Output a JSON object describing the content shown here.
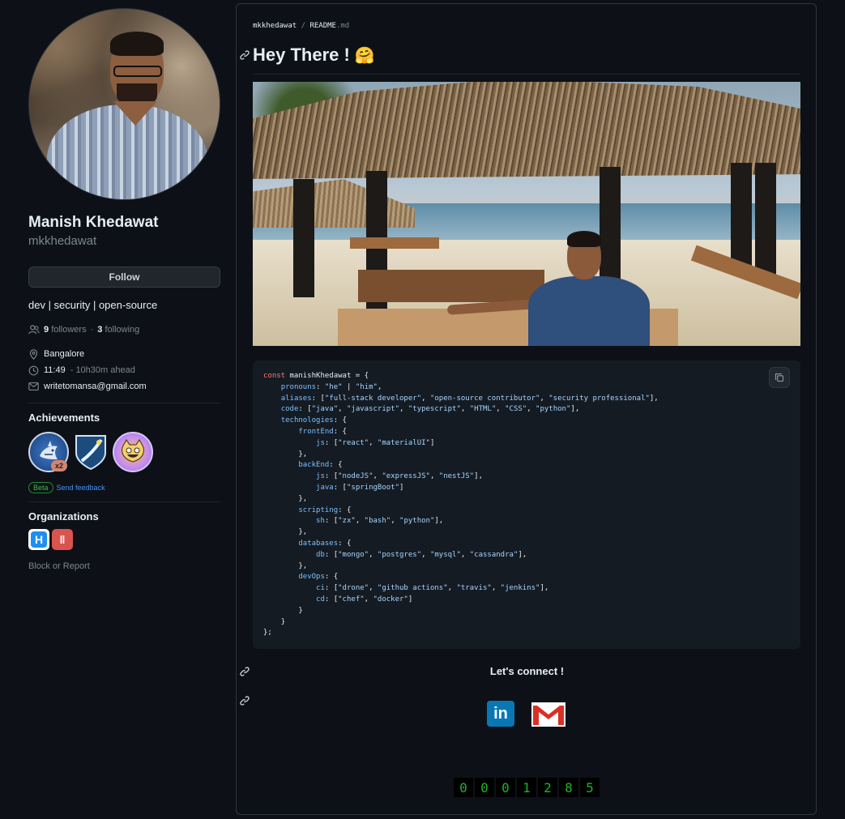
{
  "profile": {
    "name": "Manish Khedawat",
    "login": "mkkhedawat",
    "follow_label": "Follow",
    "bio": "dev | security | open-source",
    "followers_count": "9",
    "followers_label": "followers",
    "separator": "·",
    "following_count": "3",
    "following_label": "following",
    "location": "Bangalore",
    "time": "11:49",
    "time_offset": "- 10h30m ahead",
    "email": "writetomansa@gmail.com"
  },
  "achievements": {
    "title": "Achievements",
    "shark_count": "x2",
    "beta_label": "Beta",
    "feedback_label": "Send feedback"
  },
  "organizations": {
    "title": "Organizations",
    "org1_letter": "H",
    "org2_letter": "‖"
  },
  "block_label": "Block or Report",
  "readme": {
    "owner": "mkkhedawat",
    "slash": "/",
    "file": "README",
    "ext": ".md",
    "heading": "Hey There !",
    "heading_emoji": "🤗",
    "connect_heading": "Let's connect !",
    "linkedin_label": "in",
    "counter_digits": [
      "0",
      "0",
      "0",
      "1",
      "2",
      "8",
      "5"
    ]
  },
  "code_lines": [
    {
      "kw": "const",
      "rest": " manishKhedawat = {"
    },
    {
      "indent": "    ",
      "prop": "pronouns",
      "rest": ": \"he\" | \"him\","
    },
    {
      "indent": "    ",
      "prop": "aliases",
      "rest": ": [\"full-stack developer\", \"open-source contributor\", \"security professional\"],"
    },
    {
      "indent": "    ",
      "prop": "code",
      "rest": ": [\"java\", \"javascript\", \"typescript\", \"HTML\", \"CSS\", \"python\"],"
    },
    {
      "indent": "    ",
      "prop": "technologies",
      "rest": ": {"
    },
    {
      "indent": "        ",
      "prop": "frontEnd",
      "rest": ": {"
    },
    {
      "indent": "            ",
      "prop": "js",
      "rest": ": [\"react\", \"materialUI\"]"
    },
    {
      "indent": "        ",
      "rest": "},"
    },
    {
      "indent": "        ",
      "prop": "backEnd",
      "rest": ": {"
    },
    {
      "indent": "            ",
      "prop": "js",
      "rest": ": [\"nodeJS\", \"expressJS\", \"nestJS\"],"
    },
    {
      "indent": "            ",
      "prop": "java",
      "rest": ": [\"springBoot\"]"
    },
    {
      "indent": "        ",
      "rest": "},"
    },
    {
      "indent": "        ",
      "prop": "scripting",
      "rest": ": {"
    },
    {
      "indent": "            ",
      "prop": "sh",
      "rest": ": [\"zx\", \"bash\", \"python\"],"
    },
    {
      "indent": "        ",
      "rest": "},"
    },
    {
      "indent": "        ",
      "prop": "databases",
      "rest": ": {"
    },
    {
      "indent": "            ",
      "prop": "db",
      "rest": ": [\"mongo\", \"postgres\", \"mysql\", \"cassandra\"],"
    },
    {
      "indent": "        ",
      "rest": "},"
    },
    {
      "indent": "        ",
      "prop": "devOps",
      "rest": ": {"
    },
    {
      "indent": "            ",
      "prop": "ci",
      "rest": ": [\"drone\", \"github actions\", \"travis\", \"jenkins\"],"
    },
    {
      "indent": "            ",
      "prop": "cd",
      "rest": ": [\"chef\", \"docker\"]"
    },
    {
      "indent": "        ",
      "rest": "}"
    },
    {
      "indent": "    ",
      "rest": "}"
    },
    {
      "rest": "};"
    }
  ],
  "icons": {
    "people": "people-icon",
    "location": "location-icon",
    "clock": "clock-icon",
    "mail": "mail-icon",
    "link": "link-icon",
    "copy": "copy-icon"
  },
  "colors": {
    "background": "#0d1117",
    "accent_link": "#4493f8",
    "beta_green": "#3fb950",
    "counter_green": "#18b52a"
  }
}
